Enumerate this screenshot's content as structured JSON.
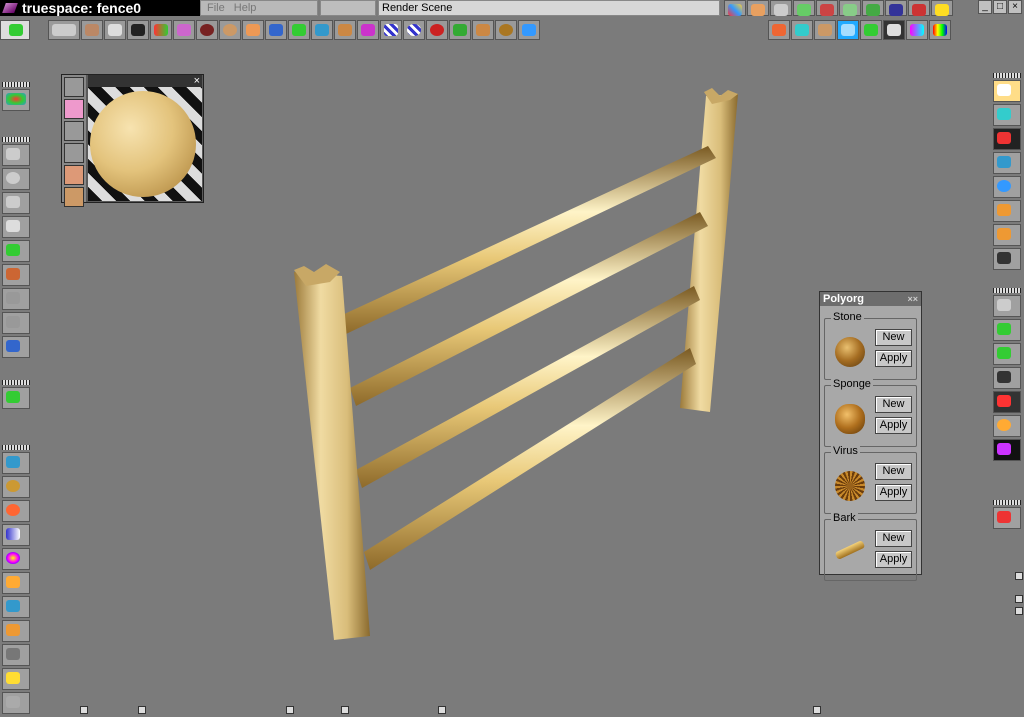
{
  "window": {
    "title": "truespace: fence0",
    "menu": [
      "File",
      "Help"
    ],
    "render_field": "Render Scene"
  },
  "top_toolbar_left": [
    "obj-icon",
    "vase-icon",
    "lathe-icon",
    "camera-icon",
    "spline-icon",
    "deform-icon",
    "boolean-icon",
    "wood-object-icon",
    "sponge-icon",
    "paint-icon",
    "triangle-icon",
    "plane-icon",
    "palette-icon",
    "sweep-icon",
    "checker-icon",
    "sphere-checker-icon",
    "torus-icon",
    "net-icon",
    "figure-icon",
    "stone-icon",
    "3d-icon"
  ],
  "top_toolbar_right": [
    "cube-render-icon",
    "wave-icon",
    "landscape-icon",
    "2x-icon",
    "render-toggle-icon",
    "no-for-icon",
    "color-swatch-icon",
    "rainbow-icon"
  ],
  "top_toolbar_mid": [
    "color-cubes-icon",
    "box-icon",
    "window-icon",
    "house-icon",
    "scene-icon",
    "diagonal-icon",
    "x-icon",
    "axis-icon",
    "2d-icon",
    "close-yellow-icon"
  ],
  "left_toolbar": [
    "render-eye-icon",
    "axis-move-icon",
    "rotate-icon",
    "scale-icon",
    "pan-icon",
    "walk-icon",
    "drop-icon",
    "up-arrow-icon",
    "down-arrow-icon",
    "layers-icon",
    "stack-icon",
    "image-icon",
    "lasso-icon",
    "balls-icon",
    "cone-icon",
    "color-wheel-icon",
    "box-open-icon",
    "shapes-icon",
    "box-grid-icon",
    "tools-icon",
    "pencil-icon",
    "recycle-icon"
  ],
  "right_toolbar": [
    "pointer-icon",
    "select-arrow-icon",
    "select-icon",
    "cube-move-icon",
    "rotate-cube-icon",
    "move-cube-icon",
    "scale-cube-icon",
    "save-icon",
    "zoom-icon",
    "grid-icon",
    "grid-move-icon",
    "lock-icon",
    "hide-icon",
    "orb-icon",
    "rotoscope-icon",
    "delete-icon"
  ],
  "material": {
    "tabs": [
      "film-icon",
      "funnel-icon",
      "hammer-icon",
      "wrench-icon",
      "cylinder-icon",
      "ball-icon"
    ],
    "close": "×"
  },
  "polyorg": {
    "title": "Polyorg",
    "groups": [
      {
        "label": "Stone",
        "new": "New",
        "apply": "Apply",
        "icon": "stone-icon"
      },
      {
        "label": "Sponge",
        "new": "New",
        "apply": "Apply",
        "icon": "sponge-icon"
      },
      {
        "label": "Virus",
        "new": "New",
        "apply": "Apply",
        "icon": "virus-icon"
      },
      {
        "label": "Bark",
        "new": "New",
        "apply": "Apply",
        "icon": "bark-icon"
      }
    ]
  },
  "colors": {
    "viewport": "#7b7b7b",
    "wood_light": "#f2dc9a",
    "wood_dark": "#b58f45"
  }
}
